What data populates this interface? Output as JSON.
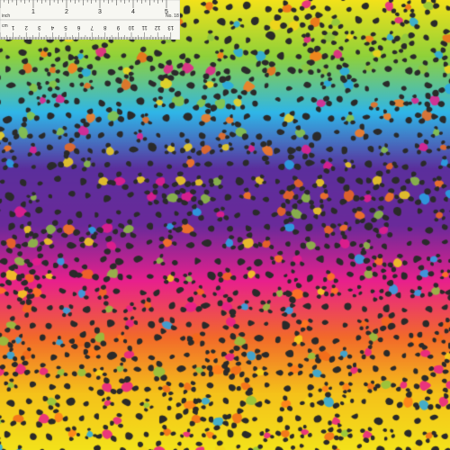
{
  "image": {
    "subject": "rainbow leopard print fabric swatch",
    "gradient_colors": [
      "#f3e21a",
      "#8fd13a",
      "#2fb6e8",
      "#5b2f9c",
      "#6a2a9a",
      "#e8208c",
      "#f26a2a",
      "#f5c21a",
      "#f3e21a"
    ],
    "spot_color": "#2a2a2a",
    "accent_colors": [
      "#f26a1a",
      "#26a8e8",
      "#e81c8c",
      "#8dc63f",
      "#f5d31a",
      "#ff7a1a"
    ]
  },
  "ruler": {
    "inch_labels": [
      "1",
      "2",
      "3",
      "4",
      "5"
    ],
    "cm_labels": [
      "1",
      "2",
      "3",
      "4",
      "5",
      "6",
      "7",
      "8",
      "9",
      "10",
      "11",
      "12",
      "13"
    ],
    "unit_top": "inch",
    "unit_bottom": "cm",
    "swatch_number": "No. 18"
  }
}
